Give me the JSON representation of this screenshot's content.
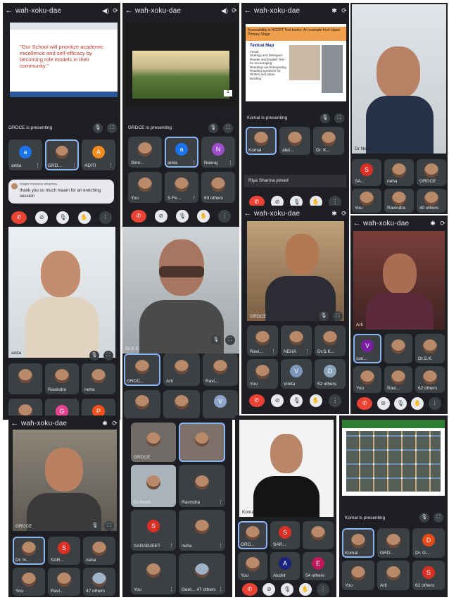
{
  "meeting_code": "wah-xoku-dae",
  "icons": {
    "back": "back-arrow-icon",
    "speaker": "speaker-icon",
    "bluetooth": "bluetooth-icon",
    "camera_switch": "camera-switch-icon"
  },
  "colors": {
    "panel": "#1e1f22",
    "tile": "#3c4043",
    "end_call": "#ea4335",
    "active_border": "#8ab4f8"
  },
  "p1": {
    "slide_text": "\"Our School will prioritize academic excellence and self-efficacy by becoming role models in their community.\"",
    "presenting": "GRDCE is presenting",
    "tiles": [
      "anita",
      "GRD...",
      "ADITI"
    ],
    "chat_name": "major monica sharma",
    "chat_text": "thank you so much maam for an enriching session"
  },
  "p2": {
    "presenting": "GRDCE is presenting",
    "tiles": [
      "Simr...",
      "anita",
      "Neeraj",
      "You",
      "S.Fe...",
      "63 others"
    ],
    "slide_num": "1"
  },
  "p3": {
    "slide_header": "Accessibility in NCERT Text books- An example from Upper Primary Stage",
    "slide_title": "Textual Map",
    "slide_bullets": [
      "Vocab",
      "Strategy and Dialogues",
      "Reader and English Text for encouraging",
      "Readings and Interpreting",
      "Reading questions for Written and Ideas Building"
    ],
    "presenting": "Komal is presenting",
    "tiles": [
      "Komal",
      "abd...",
      "Dr. K..."
    ],
    "joined": "Riya Sharma joined"
  },
  "p4": {
    "speaker": "Dr Neeti",
    "tiles": [
      "SA...",
      "neha",
      "GRDCE",
      "You",
      "Ravindra",
      "40 others"
    ]
  },
  "p5": {
    "speaker": "anita",
    "tiles": [
      "",
      "Ravindra",
      "neha",
      "",
      "",
      ""
    ],
    "letters": [
      "G",
      "P"
    ]
  },
  "p6": {
    "speaker": "Dr.S.K.",
    "tiles": [
      "GRDC...",
      "Arti",
      "Ravi...",
      "",
      "",
      ""
    ],
    "letter": "V"
  },
  "p7": {
    "speaker": "GRDCE",
    "tiles": [
      "Ravi...",
      "NEHA",
      "Dr.S.K...",
      "You",
      "Vinita",
      "52 others"
    ],
    "letter": "V"
  },
  "p8": {
    "speaker": "Arti",
    "tiles": [
      "cou...",
      "",
      "Dr.S.K.",
      "You",
      "Ravi...",
      "62 others"
    ],
    "letter": "V"
  },
  "p9": {
    "speaker": "GRDCE",
    "tiles": [
      "Dr. N...",
      "SAR...",
      "neha",
      "You",
      "Ravi...",
      "47 others"
    ],
    "letter": "S"
  },
  "p10": {
    "tiles": [
      "GRDCE",
      "",
      "Dr Neeti",
      "Ravindra",
      "SARABJEET",
      "neha",
      "You",
      "Geet... 47 others"
    ],
    "letter": "S"
  },
  "p11": {
    "speaker": "Komal",
    "tiles": [
      "GRD...",
      "SAR...",
      "",
      "You",
      "Akshit",
      "54 others"
    ],
    "letters": [
      "S",
      "A",
      "E"
    ]
  },
  "p12": {
    "presenting": "Komal is presenting",
    "tiles": [
      "Komal",
      "GRD...",
      "Dr. G...",
      "You",
      "Arti",
      "62 others"
    ],
    "letters": [
      "D",
      "S"
    ]
  }
}
